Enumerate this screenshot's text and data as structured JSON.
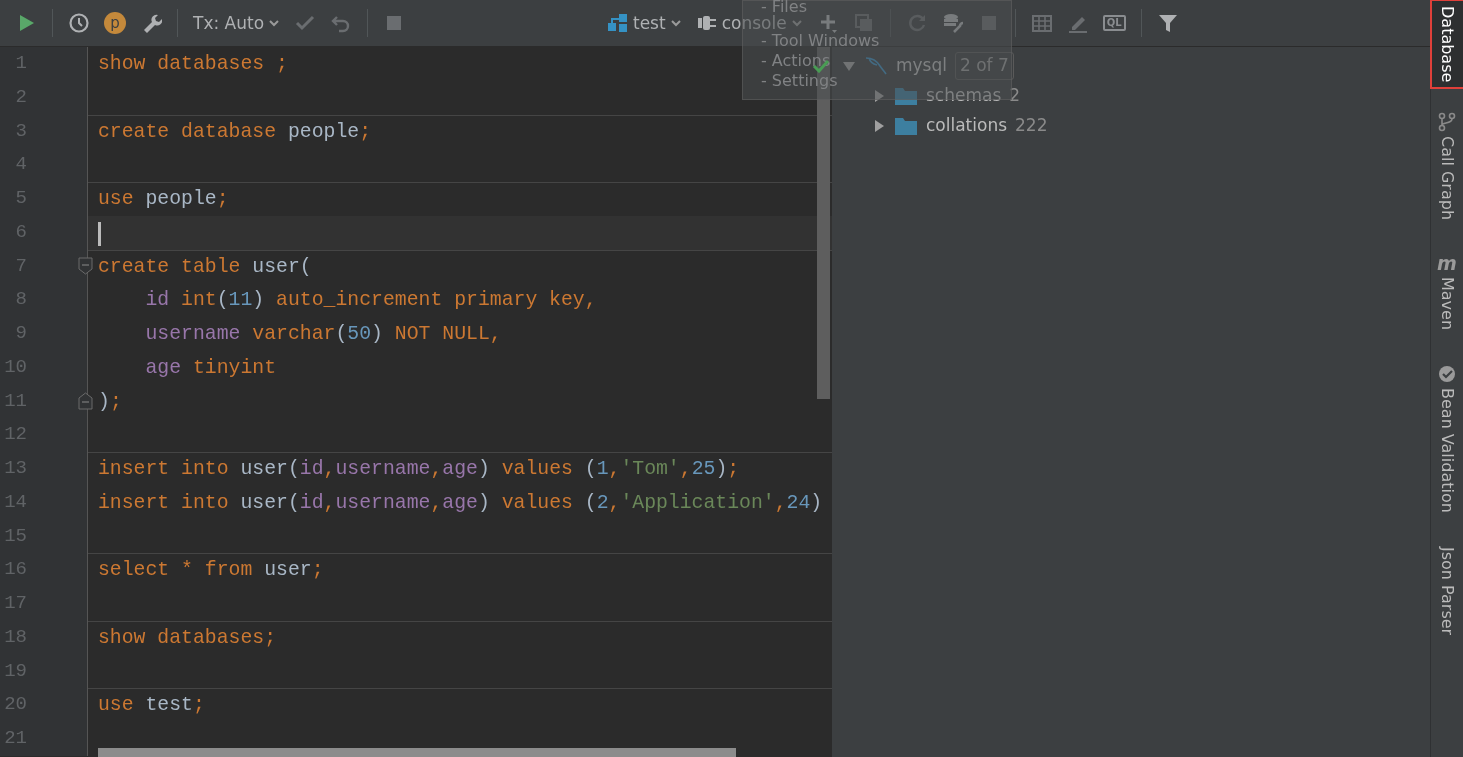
{
  "toolbar": {
    "left": [
      {
        "kind": "run",
        "disabled": false
      },
      {
        "kind": "separator"
      },
      {
        "kind": "history",
        "disabled": false
      },
      {
        "kind": "profile",
        "label": "p",
        "disabled": false
      },
      {
        "kind": "wrench",
        "disabled": false
      },
      {
        "kind": "separator"
      },
      {
        "kind": "dropdown",
        "label": "Tx: Auto",
        "disabled": false
      },
      {
        "kind": "commit",
        "disabled": true
      },
      {
        "kind": "rollback",
        "disabled": true
      },
      {
        "kind": "separator"
      },
      {
        "kind": "stop",
        "disabled": true
      }
    ],
    "right": [
      {
        "kind": "schema",
        "label": "test",
        "disabled": false
      },
      {
        "kind": "console",
        "label": "console",
        "disabled": false
      },
      {
        "kind": "add",
        "disabled": false
      },
      {
        "kind": "copy",
        "disabled": true
      },
      {
        "kind": "separator"
      },
      {
        "kind": "refresh",
        "disabled": true
      },
      {
        "kind": "dbtool",
        "disabled": false
      },
      {
        "kind": "stop",
        "disabled": true
      },
      {
        "kind": "separator"
      },
      {
        "kind": "table",
        "disabled": true
      },
      {
        "kind": "edit",
        "disabled": true
      },
      {
        "kind": "ql",
        "label": "QL",
        "disabled": true
      },
      {
        "kind": "separator"
      },
      {
        "kind": "filter",
        "disabled": false
      }
    ]
  },
  "popup": {
    "items": [
      "- Files",
      "- Tool Windows",
      "- Actions",
      "- Settings"
    ]
  },
  "editor": {
    "lines": [
      {
        "number": "1",
        "kind": "plain",
        "separator": false,
        "current": false,
        "code": [
          {
            "text": "show databases ;",
            "kind": "keyword"
          }
        ]
      },
      {
        "number": "2",
        "kind": "plain",
        "separator": false,
        "current": false
      },
      {
        "number": "3",
        "kind": "plain",
        "separator": true,
        "current": false,
        "code": [
          {
            "text": "create database ",
            "kind": "keyword"
          },
          {
            "text": "people",
            "kind": "name"
          },
          {
            "text": ";",
            "kind": "punct"
          }
        ]
      },
      {
        "number": "4",
        "kind": "plain",
        "separator": false,
        "current": false
      },
      {
        "number": "5",
        "kind": "plain",
        "separator": true,
        "current": false,
        "code": [
          {
            "text": "use ",
            "kind": "keyword"
          },
          {
            "text": "people",
            "kind": "name"
          },
          {
            "text": ";",
            "kind": "punct"
          }
        ]
      },
      {
        "number": "6",
        "kind": "plain",
        "separator": false,
        "current": true
      },
      {
        "number": "7",
        "kind": "fold-start",
        "separator": true,
        "current": false,
        "code": [
          {
            "text": "create table ",
            "kind": "keyword"
          },
          {
            "text": "user(",
            "kind": "name"
          }
        ]
      },
      {
        "number": "8",
        "kind": "plain",
        "separator": false,
        "current": false,
        "code": [
          {
            "text": "    id",
            "kind": "column"
          },
          {
            "text": " int",
            "kind": "keyword"
          },
          {
            "text": "(",
            "kind": "plain"
          },
          {
            "text": "11",
            "kind": "number"
          },
          {
            "text": ") ",
            "kind": "plain"
          },
          {
            "text": "auto_increment primary key,",
            "kind": "keyword"
          }
        ]
      },
      {
        "number": "9",
        "kind": "plain",
        "separator": false,
        "current": false,
        "code": [
          {
            "text": "    username",
            "kind": "column"
          },
          {
            "text": " varchar",
            "kind": "keyword"
          },
          {
            "text": "(",
            "kind": "plain"
          },
          {
            "text": "50",
            "kind": "number"
          },
          {
            "text": ") ",
            "kind": "plain"
          },
          {
            "text": "NOT NULL,",
            "kind": "keyword"
          }
        ]
      },
      {
        "number": "10",
        "kind": "plain",
        "separator": false,
        "current": false,
        "code": [
          {
            "text": "    age",
            "kind": "column"
          },
          {
            "text": " tinyint",
            "kind": "keyword"
          }
        ]
      },
      {
        "number": "11",
        "kind": "fold-end",
        "separator": false,
        "current": false,
        "code": [
          {
            "text": ")",
            "kind": "plain"
          },
          {
            "text": ";",
            "kind": "punct"
          }
        ]
      },
      {
        "number": "12",
        "kind": "plain",
        "separator": false,
        "current": false
      },
      {
        "number": "13",
        "kind": "plain",
        "separator": true,
        "current": false,
        "code": [
          {
            "text": "insert into ",
            "kind": "keyword"
          },
          {
            "text": "user(",
            "kind": "name"
          },
          {
            "text": "id",
            "kind": "column"
          },
          {
            "text": ",",
            "kind": "punct"
          },
          {
            "text": "username",
            "kind": "column"
          },
          {
            "text": ",",
            "kind": "punct"
          },
          {
            "text": "age",
            "kind": "column"
          },
          {
            "text": ") ",
            "kind": "plain"
          },
          {
            "text": "values ",
            "kind": "keyword"
          },
          {
            "text": "(",
            "kind": "plain"
          },
          {
            "text": "1",
            "kind": "number"
          },
          {
            "text": ",",
            "kind": "punct"
          },
          {
            "text": "'Tom'",
            "kind": "string"
          },
          {
            "text": ",",
            "kind": "punct"
          },
          {
            "text": "25",
            "kind": "number"
          },
          {
            "text": ")",
            "kind": "plain"
          },
          {
            "text": ";",
            "kind": "punct"
          }
        ]
      },
      {
        "number": "14",
        "kind": "plain",
        "separator": false,
        "current": false,
        "code": [
          {
            "text": "insert into ",
            "kind": "keyword"
          },
          {
            "text": "user(",
            "kind": "name"
          },
          {
            "text": "id",
            "kind": "column"
          },
          {
            "text": ",",
            "kind": "punct"
          },
          {
            "text": "username",
            "kind": "column"
          },
          {
            "text": ",",
            "kind": "punct"
          },
          {
            "text": "age",
            "kind": "column"
          },
          {
            "text": ") ",
            "kind": "plain"
          },
          {
            "text": "values ",
            "kind": "keyword"
          },
          {
            "text": "(",
            "kind": "plain"
          },
          {
            "text": "2",
            "kind": "number"
          },
          {
            "text": ",",
            "kind": "punct"
          },
          {
            "text": "'Application'",
            "kind": "string"
          },
          {
            "text": ",",
            "kind": "punct"
          },
          {
            "text": "24",
            "kind": "number"
          },
          {
            "text": ")",
            "kind": "plain"
          }
        ]
      },
      {
        "number": "15",
        "kind": "plain",
        "separator": false,
        "current": false
      },
      {
        "number": "16",
        "kind": "plain",
        "separator": true,
        "current": false,
        "code": [
          {
            "text": "select * from ",
            "kind": "keyword"
          },
          {
            "text": "user",
            "kind": "name"
          },
          {
            "text": ";",
            "kind": "punct"
          }
        ]
      },
      {
        "number": "17",
        "kind": "plain",
        "separator": false,
        "current": false
      },
      {
        "number": "18",
        "kind": "plain",
        "separator": true,
        "current": false,
        "code": [
          {
            "text": "show databases;",
            "kind": "keyword"
          }
        ]
      },
      {
        "number": "19",
        "kind": "plain",
        "separator": false,
        "current": false
      },
      {
        "number": "20",
        "kind": "plain",
        "separator": true,
        "current": false,
        "code": [
          {
            "text": "use ",
            "kind": "keyword"
          },
          {
            "text": "test",
            "kind": "name"
          },
          {
            "text": ";",
            "kind": "punct"
          }
        ]
      },
      {
        "number": "21",
        "kind": "plain",
        "separator": false,
        "current": false
      }
    ]
  },
  "tree": [
    {
      "label": "mysql",
      "badge": "2 of 7",
      "kind": "datasource",
      "connected": true,
      "expanded": true,
      "children": [
        {
          "label": "schemas",
          "count": "2",
          "kind": "folder",
          "expanded": false
        },
        {
          "label": "collations",
          "count": "222",
          "kind": "folder",
          "expanded": false
        }
      ]
    }
  ],
  "tool_strip": [
    {
      "label": "Database",
      "kind": "text",
      "selected": true,
      "highlighted": true
    },
    {
      "label": "Call Graph",
      "kind": "graph",
      "selected": false,
      "highlighted": false
    },
    {
      "label": "Maven",
      "kind": "maven",
      "glyph": "m",
      "selected": false,
      "highlighted": false
    },
    {
      "label": "Bean Validation",
      "kind": "bean",
      "selected": false,
      "highlighted": false
    },
    {
      "label": "Json Parser",
      "kind": "text",
      "selected": false,
      "highlighted": false
    }
  ]
}
